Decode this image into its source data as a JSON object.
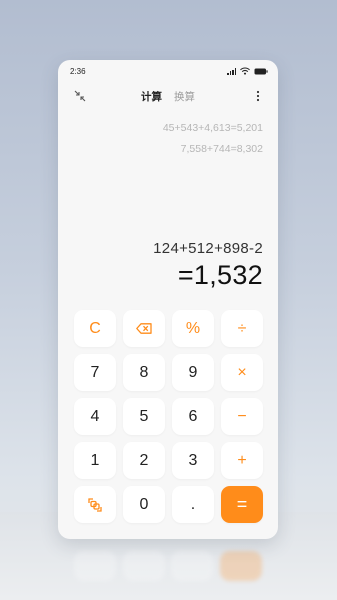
{
  "status_bar": {
    "time": "2:36",
    "icons": [
      "signal-icon",
      "wifi-icon",
      "battery-icon"
    ]
  },
  "toolbar": {
    "shrink_icon": "shrink-icon",
    "tabs": [
      {
        "label": "计算",
        "active": true
      },
      {
        "label": "换算",
        "active": false
      }
    ],
    "more_icon": "more-vertical-icon"
  },
  "display": {
    "history": [
      "45+543+4,613=5,201",
      "7,558+744=8,302"
    ],
    "expression": "124+512+898-2",
    "result": "=1,532"
  },
  "keypad": {
    "rows": [
      [
        {
          "label": "C",
          "type": "op"
        },
        {
          "label": "⌫",
          "type": "op",
          "icon": "backspace-icon"
        },
        {
          "label": "%",
          "type": "op"
        },
        {
          "label": "÷",
          "type": "op"
        }
      ],
      [
        {
          "label": "7",
          "type": "num"
        },
        {
          "label": "8",
          "type": "num"
        },
        {
          "label": "9",
          "type": "num"
        },
        {
          "label": "×",
          "type": "op"
        }
      ],
      [
        {
          "label": "4",
          "type": "num"
        },
        {
          "label": "5",
          "type": "num"
        },
        {
          "label": "6",
          "type": "num"
        },
        {
          "label": "−",
          "type": "op"
        }
      ],
      [
        {
          "label": "1",
          "type": "num"
        },
        {
          "label": "2",
          "type": "num"
        },
        {
          "label": "3",
          "type": "num"
        },
        {
          "label": "+",
          "type": "op"
        }
      ],
      [
        {
          "label": "",
          "type": "op",
          "icon": "switch-mode-icon"
        },
        {
          "label": "0",
          "type": "num"
        },
        {
          "label": ".",
          "type": "num"
        },
        {
          "label": "=",
          "type": "equals"
        }
      ]
    ]
  },
  "colors": {
    "accent": "#ff8c1a",
    "key_background": "#ffffff",
    "screen_background": "#f7f7f7",
    "history_text": "#b6b6b6"
  }
}
